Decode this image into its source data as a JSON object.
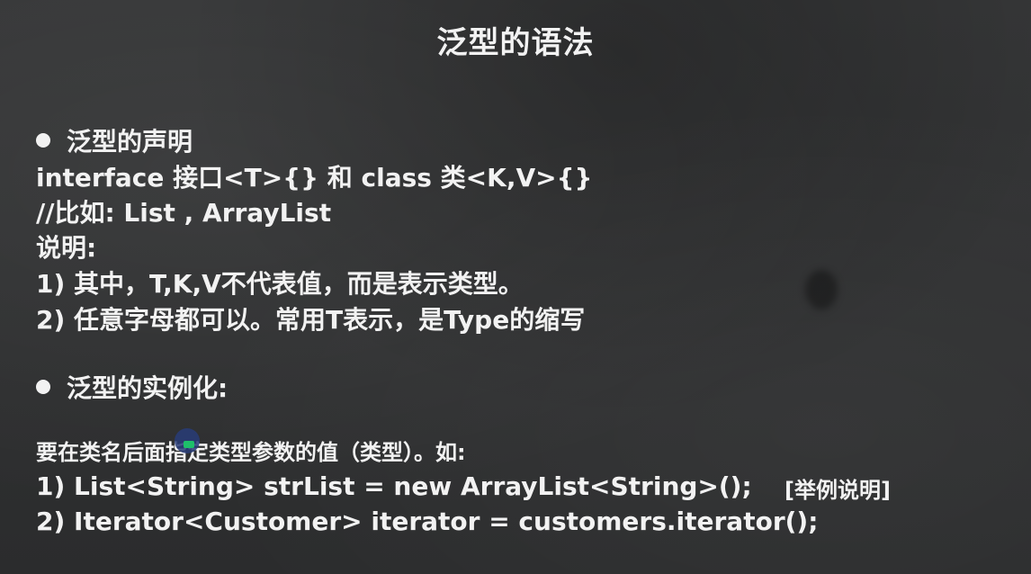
{
  "title": "泛型的语法",
  "section1": {
    "heading": "泛型的声明",
    "lines": [
      "interface 接口<T>{} 和 class 类<K,V>{}",
      "//比如: List , ArrayList",
      "说明:",
      "1) 其中，T,K,V不代表值，而是表示类型。",
      "2) 任意字母都可以。常用T表示，是Type的缩写"
    ]
  },
  "section2": {
    "heading": "泛型的实例化:",
    "intro": "要在类名后面指定类型参数的值（类型）。如:",
    "lines": [
      "1) List<String> strList = new ArrayList<String>();",
      "2) Iterator<Customer> iterator = customers.iterator();"
    ],
    "note": "[举例说明]"
  },
  "icons": [
    "bullet-icon",
    "cursor-icon"
  ],
  "colors": {
    "background": "#2f3031",
    "text": "#f2f2f2"
  }
}
